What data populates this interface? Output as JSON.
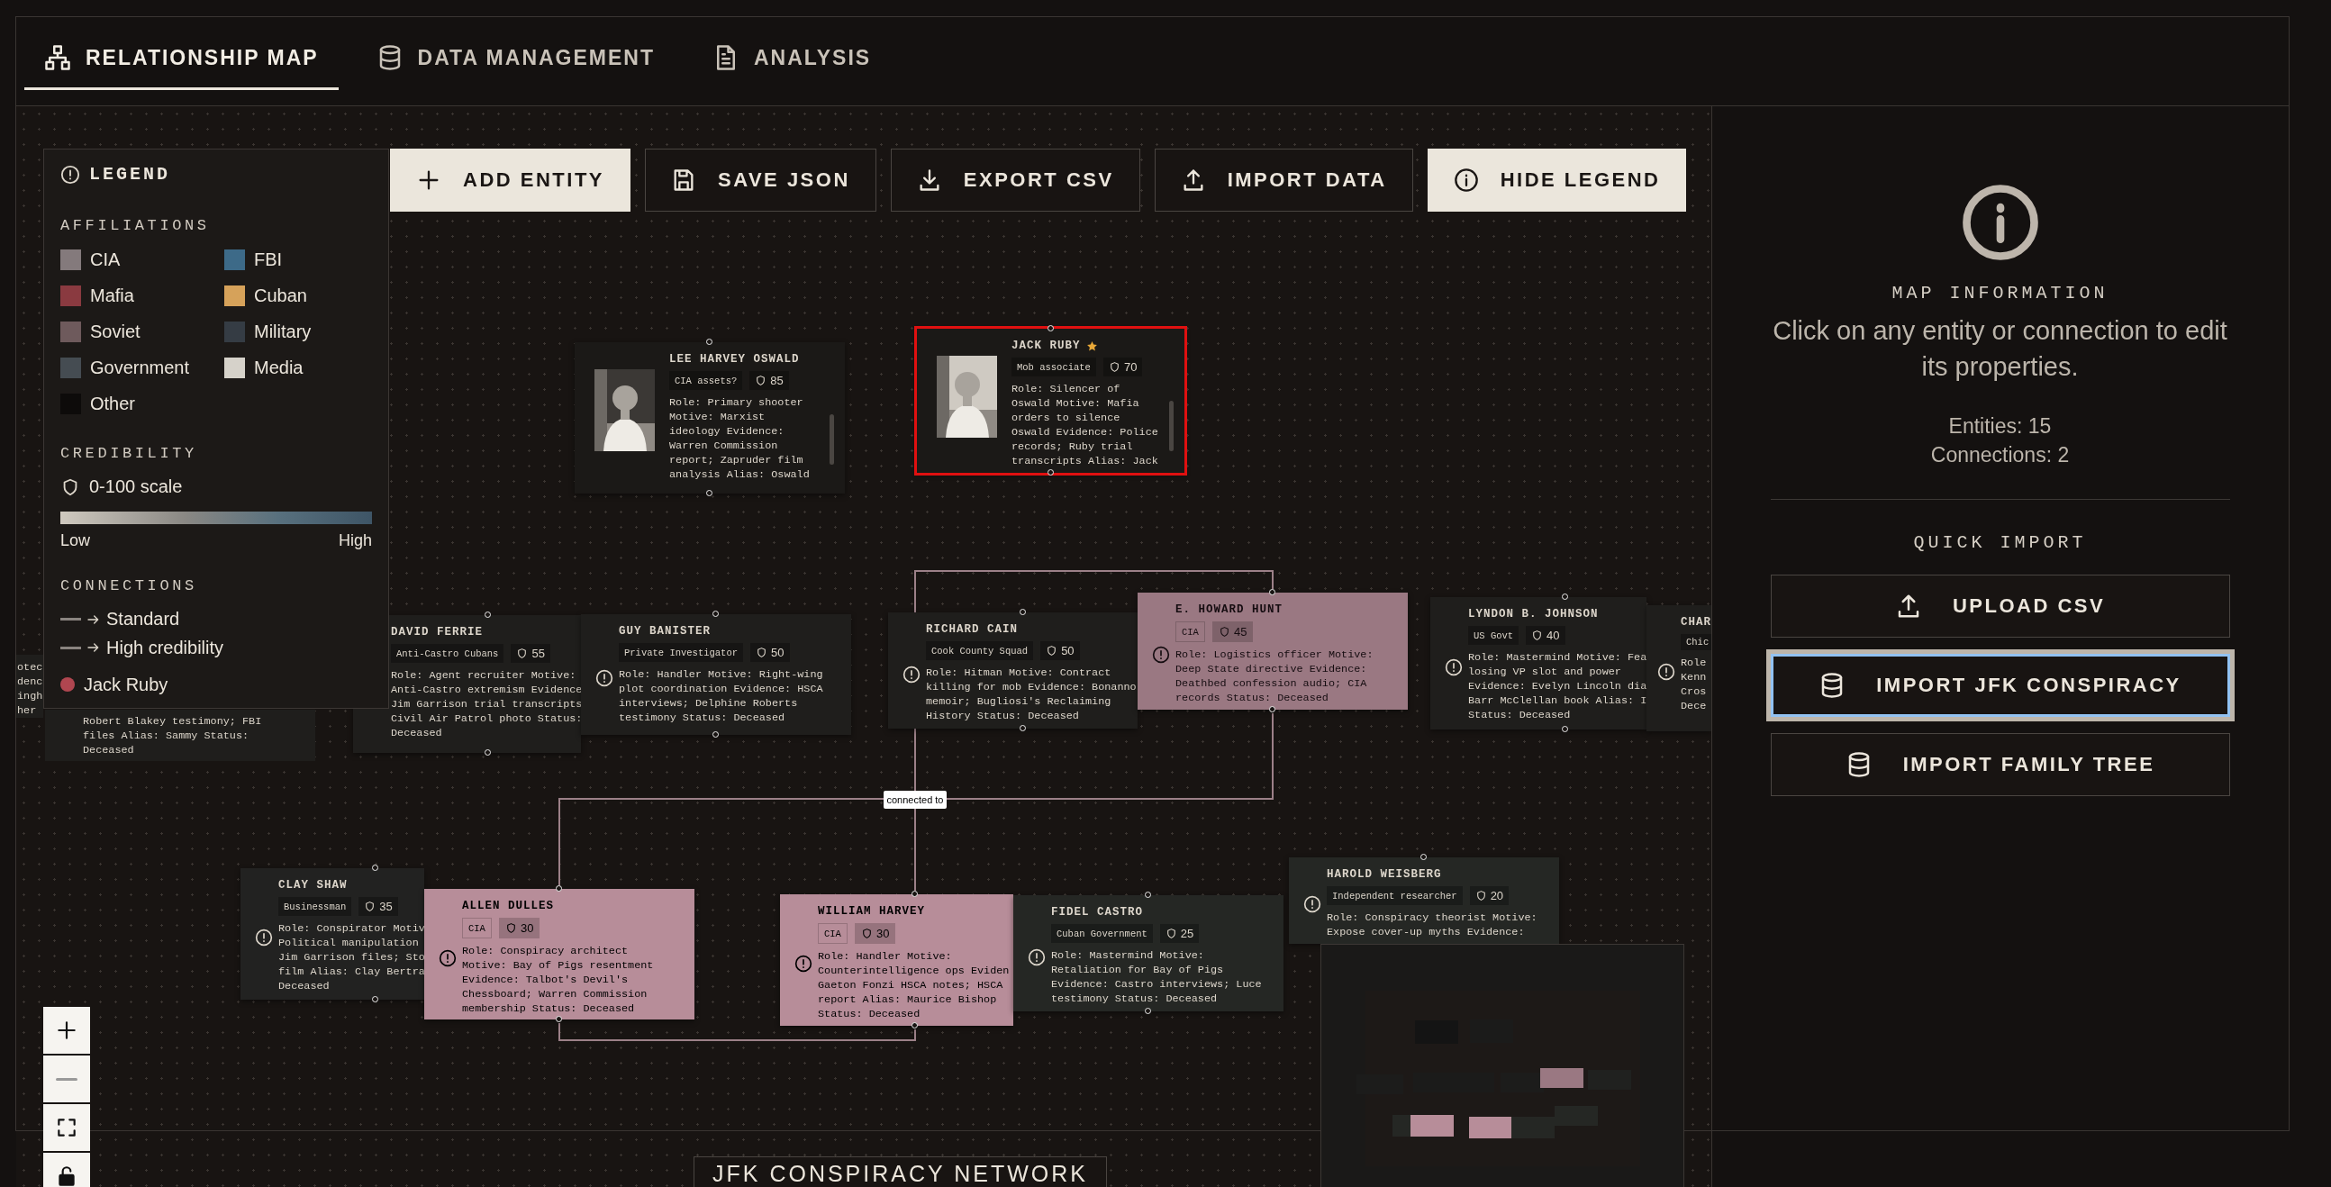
{
  "tabs": [
    {
      "label": "RELATIONSHIP MAP",
      "selected": true
    },
    {
      "label": "DATA MANAGEMENT",
      "selected": false
    },
    {
      "label": "ANALYSIS",
      "selected": false
    }
  ],
  "toolbar": [
    {
      "label": "ADD ENTITY",
      "kind": "filled"
    },
    {
      "label": "SAVE JSON",
      "kind": "outline"
    },
    {
      "label": "EXPORT CSV",
      "kind": "outline"
    },
    {
      "label": "IMPORT DATA",
      "kind": "outline"
    },
    {
      "label": "HIDE LEGEND",
      "kind": "filled"
    }
  ],
  "legend": {
    "title": "LEGEND",
    "affiliations_heading": "AFFILIATIONS",
    "affiliations": [
      {
        "label": "CIA",
        "color": "#847a7c"
      },
      {
        "label": "FBI",
        "color": "#3d6a88"
      },
      {
        "label": "Mafia",
        "color": "#8a3a40"
      },
      {
        "label": "Cuban",
        "color": "#d6a25a"
      },
      {
        "label": "Soviet",
        "color": "#6e5a5c"
      },
      {
        "label": "Military",
        "color": "#353c44"
      },
      {
        "label": "Government",
        "color": "#454c52"
      },
      {
        "label": "Media",
        "color": "#d6d2ca"
      },
      {
        "label": "Other",
        "color": "#0d0b0a"
      }
    ],
    "credibility_heading": "CREDIBILITY",
    "scale_label": "0-100 scale",
    "low": "Low",
    "high": "High",
    "connections_heading": "CONNECTIONS",
    "connections": [
      {
        "label": "Standard"
      },
      {
        "label": "High credibility"
      }
    ],
    "selected_entity": {
      "label": "Jack Ruby",
      "color": "#b04650"
    }
  },
  "map": {
    "edge_label": "connected to",
    "nodes": [
      {
        "kind": "partial",
        "desc": "otec\ndenc\ningh\nher",
        "color": "#1f1e1c",
        "selected": false,
        "faded": false
      },
      {
        "kind": "partial",
        "desc": "Robert Blakey testimony; FBI\nfiles Alias: Sammy Status:\nDeceased",
        "color": "#1f1e1c",
        "selected": false,
        "faded": false
      },
      {
        "title": "LEE HARVEY OSWALD",
        "starred": false,
        "tag": "CIA assets?",
        "credibility": "85",
        "desc": "Role: Primary shooter\nMotive: Marxist\nideology Evidence:\nWarren Commission\nreport; Zapruder film\nanalysis Alias: Oswald",
        "color": "#1b1917",
        "selected": false,
        "faded": false
      },
      {
        "title": "JACK RUBY",
        "starred": true,
        "tag": "Mob associate",
        "credibility": "70",
        "desc": "Role: Silencer of\nOswald Motive: Mafia\norders to silence\nOswald Evidence: Police\nrecords; Ruby trial\ntranscripts Alias: Jack",
        "color": "#1b1917",
        "selected": true,
        "faded": false
      },
      {
        "kind": "note",
        "title": "DAVID FERRIE",
        "starred": false,
        "tag": "Anti-Castro Cubans",
        "credibility": "55",
        "desc": "Role: Agent recruiter Motive:\nAnti-Castro extremism Evidence\nJim Garrison trial transcripts\nCivil Air Patrol photo Status:\nDeceased",
        "color": "#1f1e1c",
        "selected": false,
        "faded": false
      },
      {
        "kind": "note",
        "title": "GUY BANISTER",
        "starred": false,
        "tag": "Private Investigator",
        "credibility": "50",
        "desc": "Role: Handler Motive: Right-wing\nplot coordination Evidence: HSCA\ninterviews; Delphine Roberts\ntestimony Status: Deceased",
        "color": "#1f1e1c",
        "selected": false,
        "faded": false
      },
      {
        "kind": "note",
        "title": "RICHARD CAIN",
        "starred": false,
        "tag": "Cook County Squad",
        "credibility": "50",
        "desc": "Role: Hitman Motive: Contract\nkilling for mob Evidence: Bonanno\nmemoir; Bugliosi's Reclaiming\nHistory Status: Deceased",
        "color": "#1f1e1c",
        "selected": false,
        "faded": false
      },
      {
        "kind": "note",
        "title": "E. HOWARD HUNT",
        "starred": false,
        "tag": "CIA",
        "credibility": "45",
        "desc": "Role: Logistics officer Motive:\nDeep State directive Evidence:\nDeathbed confession audio; CIA\nrecords Status: Deceased",
        "color": "#9a7882",
        "selected": false,
        "faded": true
      },
      {
        "kind": "note",
        "title": "LYNDON B. JOHNSON",
        "starred": false,
        "tag": "US Govt",
        "credibility": "40",
        "desc": "Role: Mastermind Motive: Fea\nlosing VP slot and power\nEvidence: Evelyn Lincoln dia\nBarr McClellan book Alias: I\nStatus: Deceased",
        "color": "#1f1e1c",
        "selected": false,
        "faded": false
      },
      {
        "kind": "note",
        "title": "CHAR",
        "starred": false,
        "tag": "Chic",
        "desc": "Role\nKenn\nCros\nDece",
        "color": "#1f1e1c",
        "selected": false,
        "faded": false
      },
      {
        "kind": "note",
        "title": "CLAY SHAW",
        "starred": false,
        "tag": "Businessman",
        "credibility": "35",
        "desc": "Role: Conspirator Motiv\nPolitical manipulation\nJim Garrison files; Sto\nfilm Alias: Clay Bertra\nDeceased",
        "color": "#222221",
        "selected": false,
        "faded": false
      },
      {
        "kind": "note",
        "title": "ALLEN DULLES",
        "starred": false,
        "tag": "CIA",
        "credibility": "30",
        "desc": "Role: Conspiracy architect\nMotive: Bay of Pigs resentment\nEvidence: Talbot's Devil's\nChessboard; Warren Commission\nmembership Status: Deceased",
        "color": "#b78d99",
        "selected": false,
        "faded": false
      },
      {
        "kind": "note",
        "title": "WILLIAM HARVEY",
        "starred": false,
        "tag": "CIA",
        "credibility": "30",
        "desc": "Role: Handler Motive:\nCounterintelligence ops Eviden\nGaeton Fonzi HSCA notes; HSCA\nreport Alias: Maurice Bishop\nStatus: Deceased",
        "color": "#b78d99",
        "selected": false,
        "faded": false
      },
      {
        "kind": "note",
        "title": "FIDEL CASTRO",
        "starred": false,
        "tag": "Cuban Government",
        "credibility": "25",
        "desc": "Role: Mastermind Motive:\nRetaliation for Bay of Pigs\nEvidence: Castro interviews; Luce\ntestimony Status: Deceased",
        "color": "#252724",
        "selected": false,
        "faded": false
      },
      {
        "kind": "note",
        "title": "HAROLD WEISBERG",
        "starred": false,
        "tag": "Independent researcher",
        "credibility": "20",
        "desc": "Role: Conspiracy theorist Motive:\nExpose cover-up myths Evidence:",
        "color": "#252724",
        "selected": false,
        "faded": false
      }
    ]
  },
  "map_title": "JFK CONSPIRACY NETWORK",
  "info_panel": {
    "title": "MAP INFORMATION",
    "hint": "Click on any entity or connection to edit its properties.",
    "entities": "Entities: 15",
    "connections": "Connections: 2",
    "quick_import_heading": "QUICK IMPORT",
    "buttons": [
      {
        "label": "UPLOAD CSV",
        "focused": false
      },
      {
        "label": "IMPORT JFK CONSPIRACY",
        "focused": true
      },
      {
        "label": "IMPORT FAMILY TREE",
        "focused": false
      }
    ]
  }
}
